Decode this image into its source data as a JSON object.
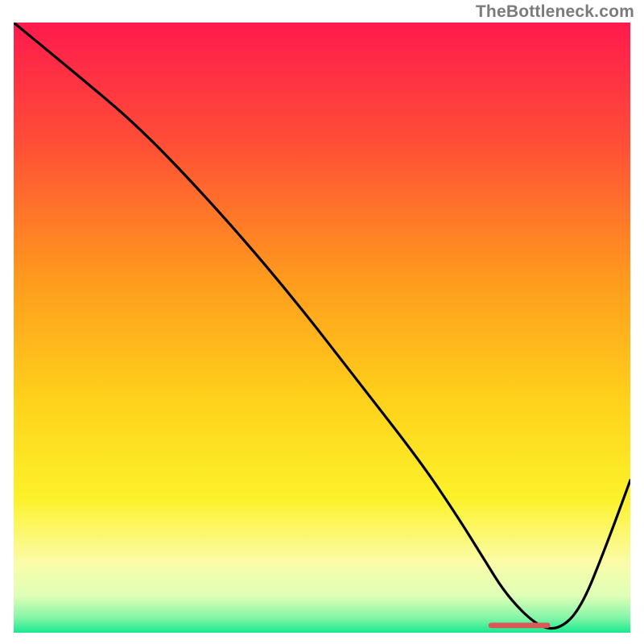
{
  "watermark": "TheBottleneck.com",
  "chart_data": {
    "type": "line",
    "title": "",
    "xlabel": "",
    "ylabel": "",
    "xlim": [
      0,
      100
    ],
    "ylim": [
      0,
      100
    ],
    "grid": false,
    "legend": false,
    "gradient_stops": [
      {
        "offset": 0.0,
        "color": "#ff1a4d"
      },
      {
        "offset": 0.2,
        "color": "#ff4f36"
      },
      {
        "offset": 0.42,
        "color": "#ff9a1d"
      },
      {
        "offset": 0.62,
        "color": "#ffd21b"
      },
      {
        "offset": 0.78,
        "color": "#fcf22a"
      },
      {
        "offset": 0.885,
        "color": "#fbfca8"
      },
      {
        "offset": 0.94,
        "color": "#deffb7"
      },
      {
        "offset": 0.975,
        "color": "#86f6a8"
      },
      {
        "offset": 1.0,
        "color": "#17e98f"
      }
    ],
    "series": [
      {
        "name": "bottleneck-curve",
        "color": "#000000",
        "x": [
          0.0,
          6.0,
          12.0,
          19.0,
          26.0,
          36.0,
          46.0,
          56.0,
          66.0,
          72.0,
          76.0,
          80.0,
          85.0,
          88.5,
          92.0,
          96.0,
          100.0
        ],
        "y": [
          100.0,
          95.0,
          90.0,
          84.0,
          77.0,
          66.0,
          54.0,
          41.0,
          28.0,
          19.0,
          12.5,
          6.0,
          1.0,
          0.5,
          4.0,
          14.0,
          25.0
        ]
      }
    ],
    "marker": {
      "name": "bottleneck-zone",
      "color": "#d85a58",
      "x_range": [
        77.0,
        87.0
      ],
      "y": 1.2,
      "height": 0.9
    }
  }
}
